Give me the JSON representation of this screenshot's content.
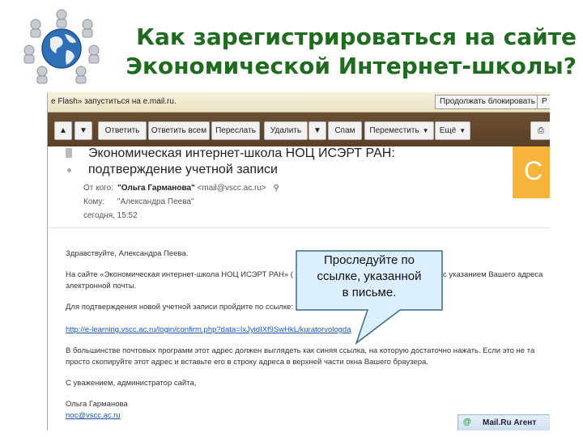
{
  "slide": {
    "title_line1": "Как зарегистрироваться на сайте",
    "title_line2": "Экономической Интернет-школы?"
  },
  "flashbar": {
    "message": "e Flash» запуститься на e.mail.ru.",
    "continue_blocking": "Продолжать блокировать",
    "cut_button": "Р"
  },
  "toolbar": {
    "reply": "Ответить",
    "reply_all": "Ответить всем",
    "forward": "Переслать",
    "delete": "Удалить",
    "spam": "Спам",
    "move": "Переместить",
    "more": "Ещё"
  },
  "email": {
    "subject_line1": "Экономическая интернет-школа НОЦ ИСЭРТ РАН:",
    "subject_line2": "подтверждение учетной записи",
    "from_label": "От кого:",
    "from_name": "\"Ольга Гарманова\"",
    "from_addr": "<mail@vscc.ac.ru>",
    "to_label": "Кому:",
    "to_name": "\"Александра Пеева\"",
    "date": "сегодня, 15:52",
    "orange_letter": "С",
    "greeting": "Здравствуйте, Александра Пеева.",
    "para1_start": "На сайте «Экономическая интернет-школа НОЦ ИСЭРТ РАН» (",
    "para1_end": "с указанием Вашего адреса",
    "para1_line2": "электронной почты.",
    "confirm_text": "Для подтверждения новой учетной записи пройдите по ссылке:",
    "confirm_link": "http://e-learning.vscc.ac.ru/login/confirm.php?data=IxJyidIXf9SwHkL/kuratorvologda",
    "para3_line1": "В большинстве почтовых программ этот адрес должен выглядеть как синяя ссылка, на которую достаточно нажать. Если это не та",
    "para3_line2": "просто скопируйте этот адрес и вставьте его в строку адреса в верхней части окна Вашего браузера.",
    "regards": "С уважением, администратор сайта,",
    "signature_name": "Ольга Гарманова",
    "signature_email": "noc@vscc.ac.ru"
  },
  "agent": {
    "label": "Mail.Ru Агент"
  },
  "callout": {
    "line1": "Проследуйте по",
    "line2": "ссылке, указанной",
    "line3": "в письме."
  },
  "colors": {
    "title_green": "#1f6b1f",
    "toolbar_brown": "#5a4029",
    "callout_fill": "#dcefff",
    "callout_border": "#3b6a8a",
    "link_blue": "#1a57b8"
  }
}
